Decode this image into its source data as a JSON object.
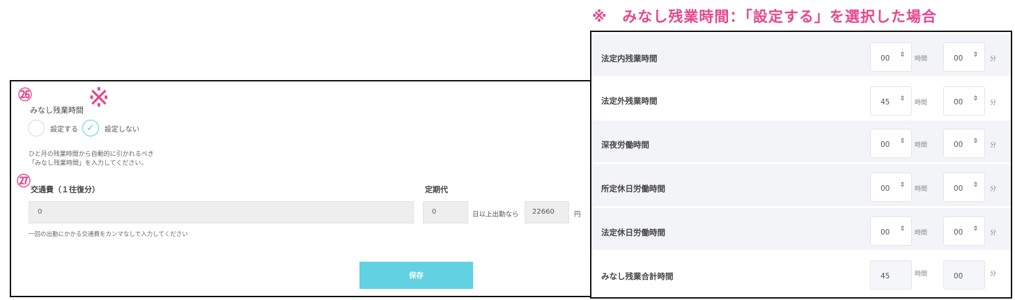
{
  "note_heading": "※　みなし残業時間：「設定する」を選択した場合",
  "left": {
    "num26": "㉖",
    "num27": "㉗",
    "asterisk": "※",
    "minashi_label": "みなし残業時間",
    "radio_set": "設定する",
    "radio_unset": "設定しない",
    "radio_checked": "radio_unset",
    "hint_line1": "ひと月の残業時間から自動的に引かれるべき",
    "hint_line2": "「みなし残業時間」を入力してください。",
    "transport_label": "交通費（１往復分）",
    "teiki_label": "定期代",
    "transport_value": "0",
    "teiki_days": "0",
    "teiki_text": "日以上出勤なら",
    "teiki_amount": "22660",
    "yen": "円",
    "hint2": "一回の出勤にかかる交通費をカンマなしで入力してください",
    "save_label": "保存"
  },
  "right": {
    "hour_unit": "時間",
    "minute_unit": "分",
    "rows": [
      {
        "label": "法定内残業時間",
        "hours": "00",
        "minutes": "00"
      },
      {
        "label": "法定外残業時間",
        "hours": "45",
        "minutes": "00"
      },
      {
        "label": "深夜労働時間",
        "hours": "00",
        "minutes": "00"
      },
      {
        "label": "所定休日労働時間",
        "hours": "00",
        "minutes": "00"
      },
      {
        "label": "法定休日労働時間",
        "hours": "00",
        "minutes": "00"
      },
      {
        "label": "みなし残業合計時間",
        "hours": "45",
        "minutes": "00"
      }
    ]
  },
  "colors": {
    "accent_pink": "#e8468e",
    "button_cyan": "#62d1e2",
    "check_cyan": "#5ecde0"
  }
}
